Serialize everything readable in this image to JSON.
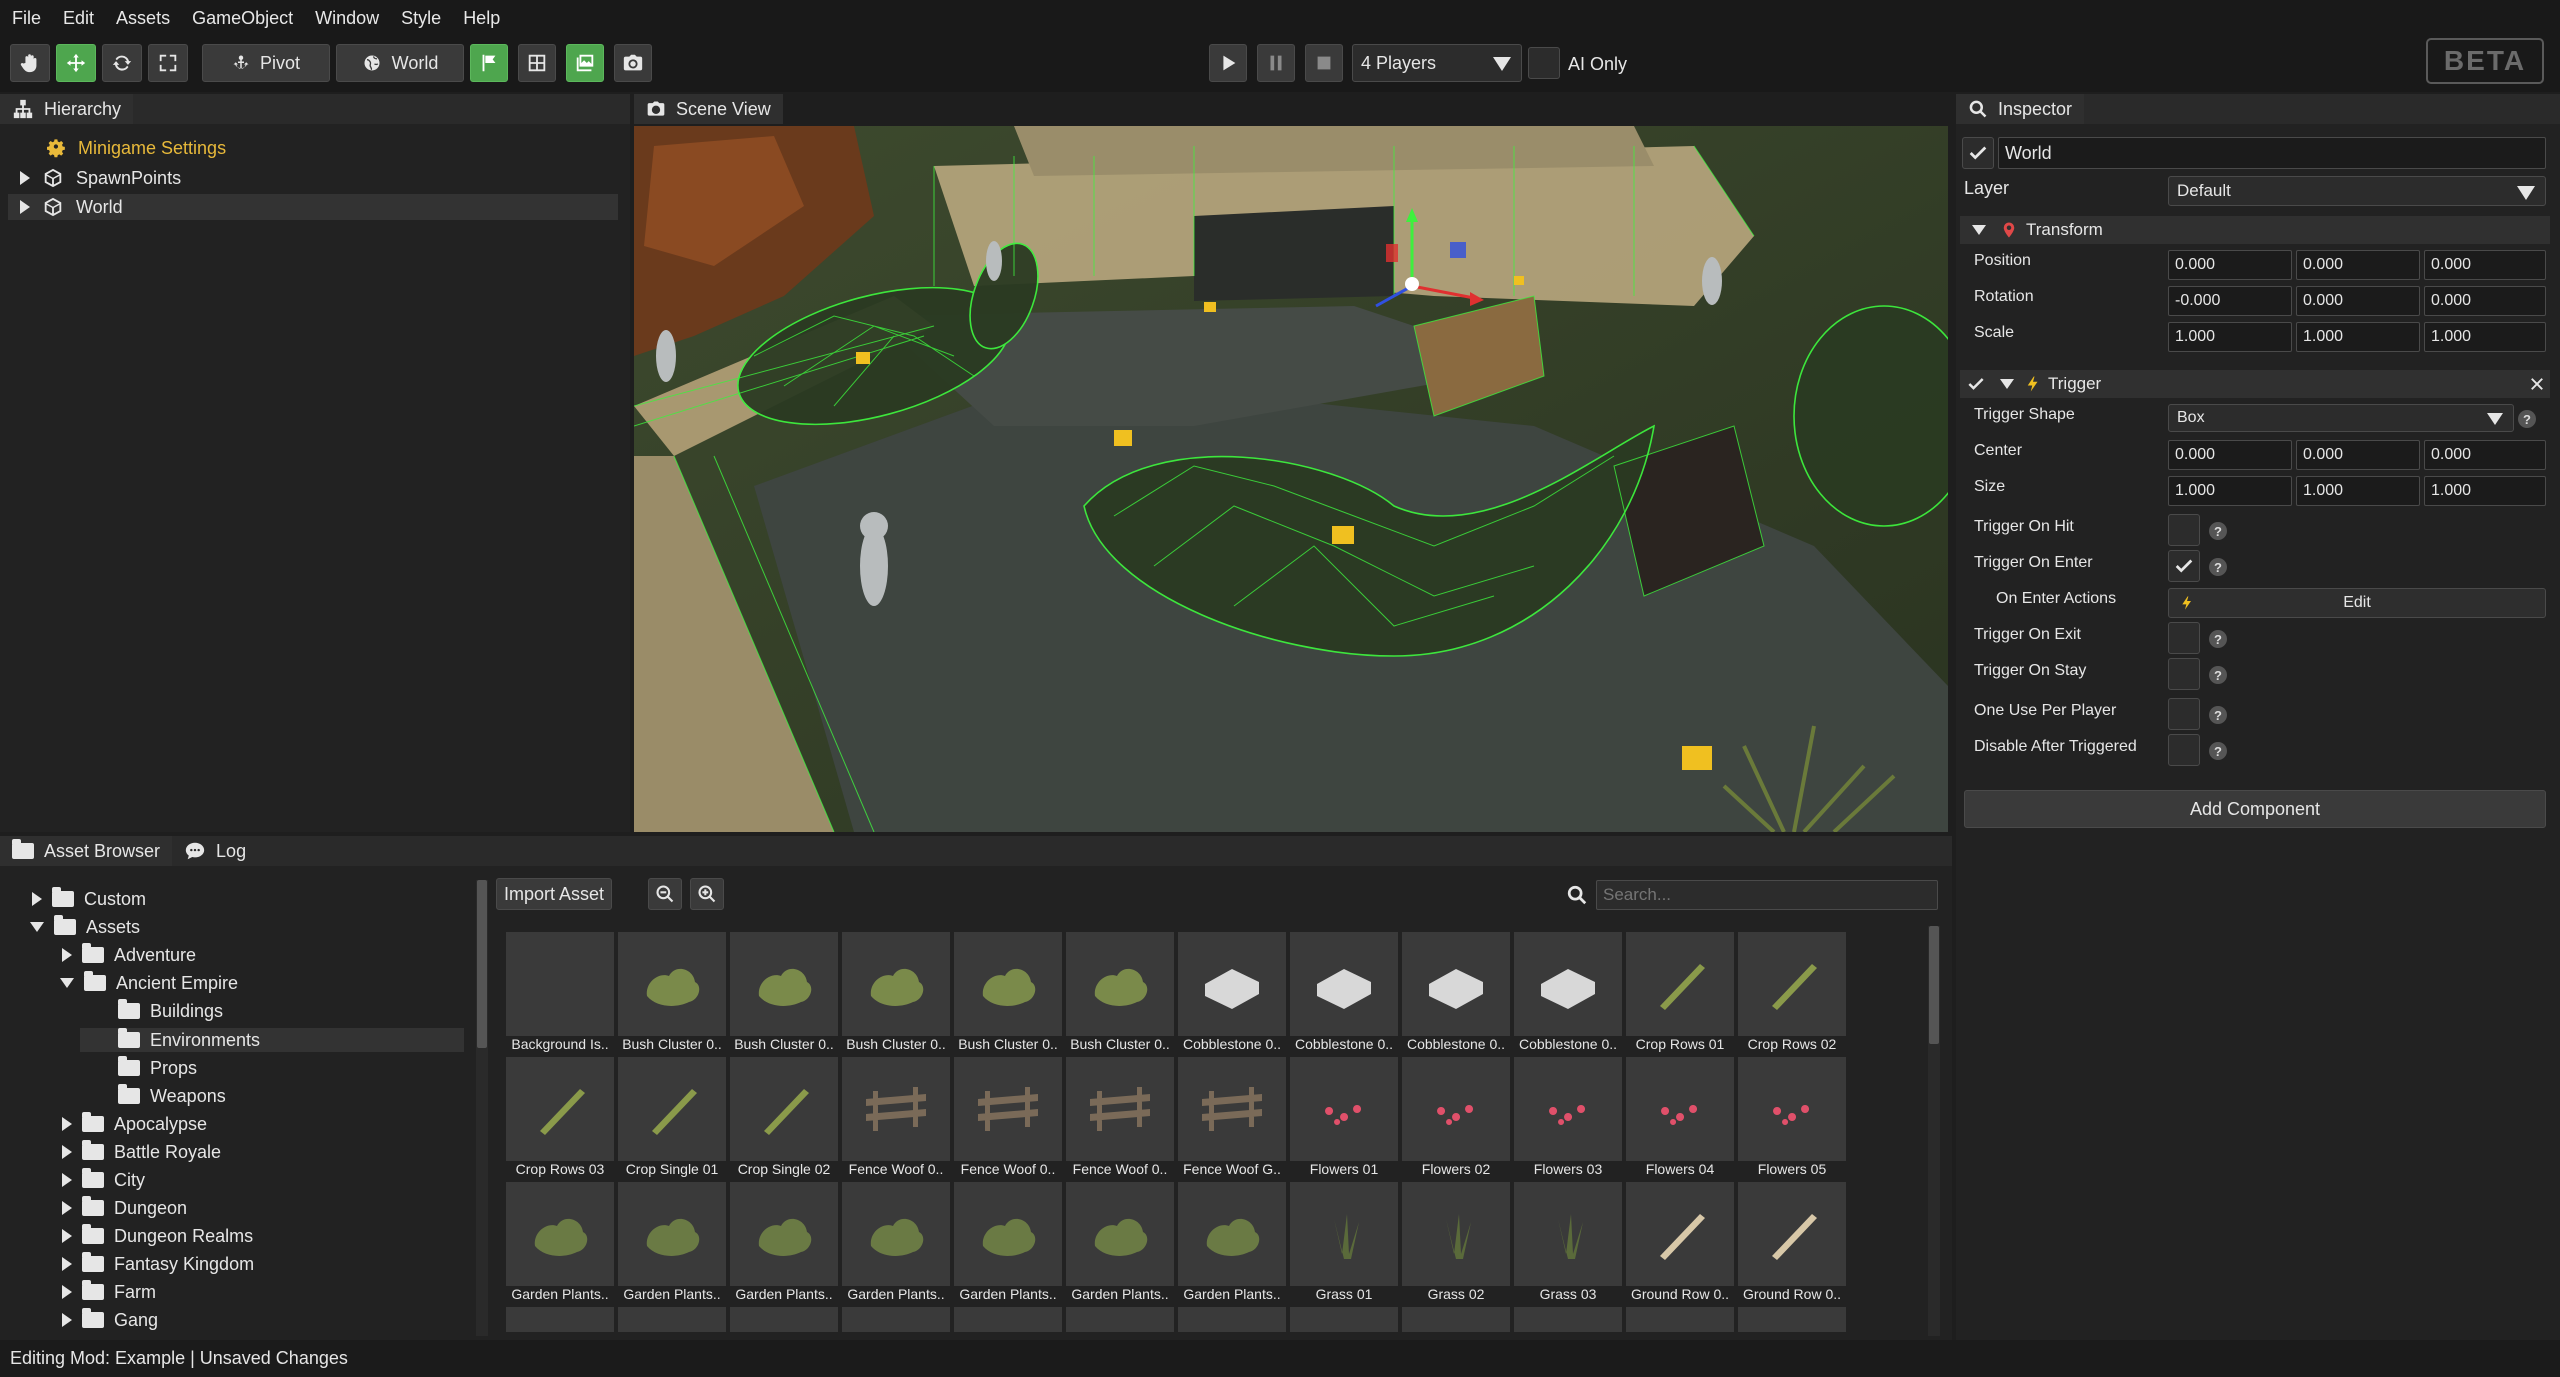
{
  "menu": [
    "File",
    "Edit",
    "Assets",
    "GameObject",
    "Window",
    "Style",
    "Help"
  ],
  "toolbar": {
    "pivot_label": "Pivot",
    "world_label": "World",
    "players_selected": "4 Players",
    "ai_only_label": "AI Only",
    "beta_label": "BETA"
  },
  "hierarchy": {
    "tab_label": "Hierarchy",
    "items": [
      {
        "label": "Minigame Settings"
      },
      {
        "label": "SpawnPoints"
      },
      {
        "label": "World"
      }
    ]
  },
  "scene": {
    "tab_label": "Scene View"
  },
  "inspector": {
    "tab_label": "Inspector",
    "object_name": "World",
    "layer_label": "Layer",
    "layer_value": "Default",
    "transform": {
      "title": "Transform",
      "position_label": "Position",
      "position": [
        "0.000",
        "0.000",
        "0.000"
      ],
      "rotation_label": "Rotation",
      "rotation": [
        "-0.000",
        "0.000",
        "0.000"
      ],
      "scale_label": "Scale",
      "scale": [
        "1.000",
        "1.000",
        "1.000"
      ]
    },
    "trigger": {
      "title": "Trigger",
      "shape_label": "Trigger Shape",
      "shape_value": "Box",
      "center_label": "Center",
      "center": [
        "0.000",
        "0.000",
        "0.000"
      ],
      "size_label": "Size",
      "size": [
        "1.000",
        "1.000",
        "1.000"
      ],
      "on_hit_label": "Trigger On Hit",
      "on_enter_label": "Trigger On Enter",
      "on_enter_actions_label": "On Enter Actions",
      "edit_label": "Edit",
      "on_exit_label": "Trigger On Exit",
      "on_stay_label": "Trigger On Stay",
      "one_use_label": "One Use Per Player",
      "disable_after_label": "Disable After Triggered"
    },
    "add_component_label": "Add Component"
  },
  "assets": {
    "tab_label": "Asset Browser",
    "log_tab_label": "Log",
    "import_label": "Import Asset",
    "search_placeholder": "Search...",
    "folders": [
      {
        "label": "Custom"
      },
      {
        "label": "Assets"
      },
      {
        "label": "Adventure"
      },
      {
        "label": "Ancient Empire"
      },
      {
        "label": "Buildings"
      },
      {
        "label": "Environments"
      },
      {
        "label": "Props"
      },
      {
        "label": "Weapons"
      },
      {
        "label": "Apocalypse"
      },
      {
        "label": "Battle Royale"
      },
      {
        "label": "City"
      },
      {
        "label": "Dungeon"
      },
      {
        "label": "Dungeon Realms"
      },
      {
        "label": "Fantasy Kingdom"
      },
      {
        "label": "Farm"
      },
      {
        "label": "Gang"
      }
    ],
    "items": [
      "Background Is..",
      "Bush Cluster 0..",
      "Bush Cluster 0..",
      "Bush Cluster 0..",
      "Bush Cluster 0..",
      "Bush Cluster 0..",
      "Cobblestone 0..",
      "Cobblestone 0..",
      "Cobblestone 0..",
      "Cobblestone 0..",
      "Crop Rows 01",
      "Crop Rows 02",
      "Crop Rows 03",
      "Crop Single 01",
      "Crop Single 02",
      "Fence Woof 0..",
      "Fence Woof 0..",
      "Fence Woof 0..",
      "Fence Woof G..",
      "Flowers 01",
      "Flowers 02",
      "Flowers 03",
      "Flowers 04",
      "Flowers 05",
      "Garden Plants..",
      "Garden Plants..",
      "Garden Plants..",
      "Garden Plants..",
      "Garden Plants..",
      "Garden Plants..",
      "Garden Plants..",
      "Grass 01",
      "Grass 02",
      "Grass 03",
      "Ground Row 0..",
      "Ground Row 0.."
    ]
  },
  "status": {
    "text": "Editing Mod: Example | Unsaved Changes"
  }
}
